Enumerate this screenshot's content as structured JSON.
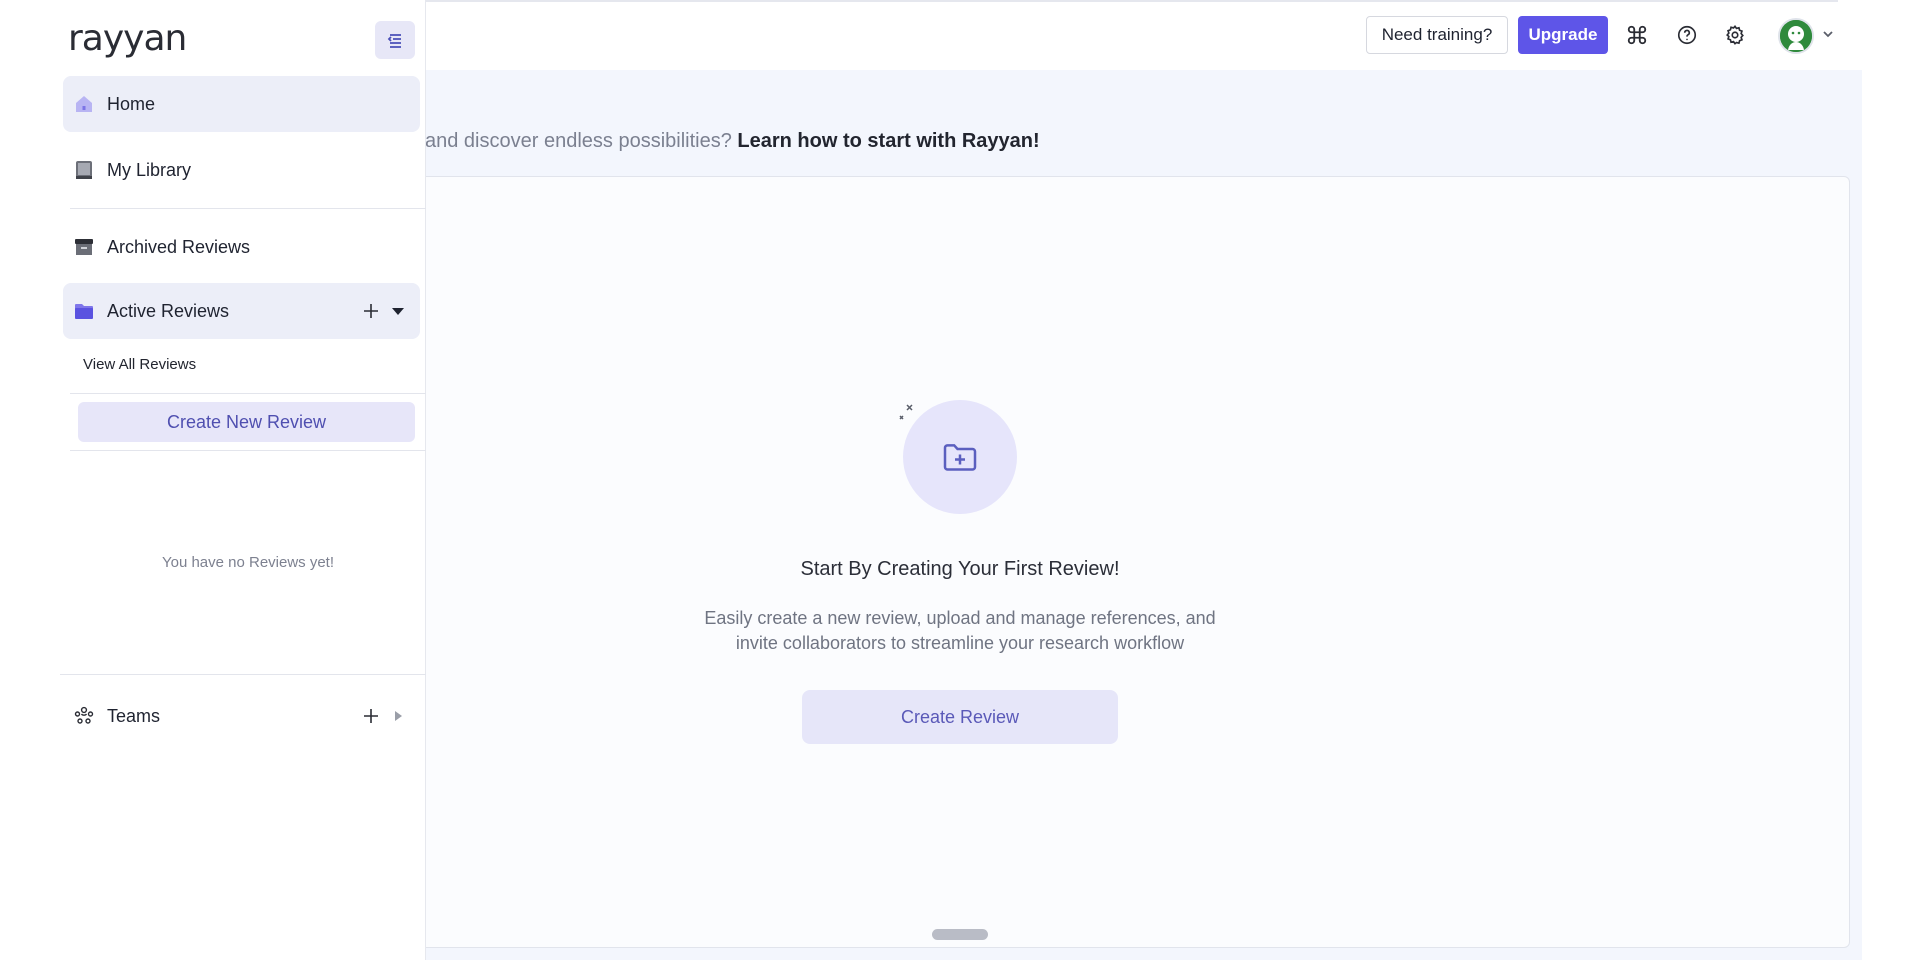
{
  "header": {
    "training_label": "Need training?",
    "upgrade_label": "Upgrade"
  },
  "sidebar": {
    "logo": "rayyan",
    "items": [
      {
        "label": "Home",
        "icon": "home-icon"
      },
      {
        "label": "My Library",
        "icon": "library-icon"
      },
      {
        "label": "Archived Reviews",
        "icon": "archive-icon"
      },
      {
        "label": "Active Reviews",
        "icon": "folder-icon"
      }
    ],
    "view_all_label": "View All Reviews",
    "create_new_review_label": "Create New Review",
    "no_reviews_text": "You have no Reviews yet!",
    "teams_label": "Teams"
  },
  "main": {
    "intro_text": "and discover endless possibilities? ",
    "intro_link": "Learn how to start with Rayyan!",
    "empty_title": "Start By Creating Your First Review!",
    "empty_desc_line1": "Easily create a new review, upload and manage references, and",
    "empty_desc_line2": "invite collaborators to streamline your research workflow",
    "create_review_label": "Create Review"
  },
  "colors": {
    "accent": "#5e55e8",
    "main_bg": "#f3f6fd",
    "active_item_bg": "#eceef8"
  }
}
